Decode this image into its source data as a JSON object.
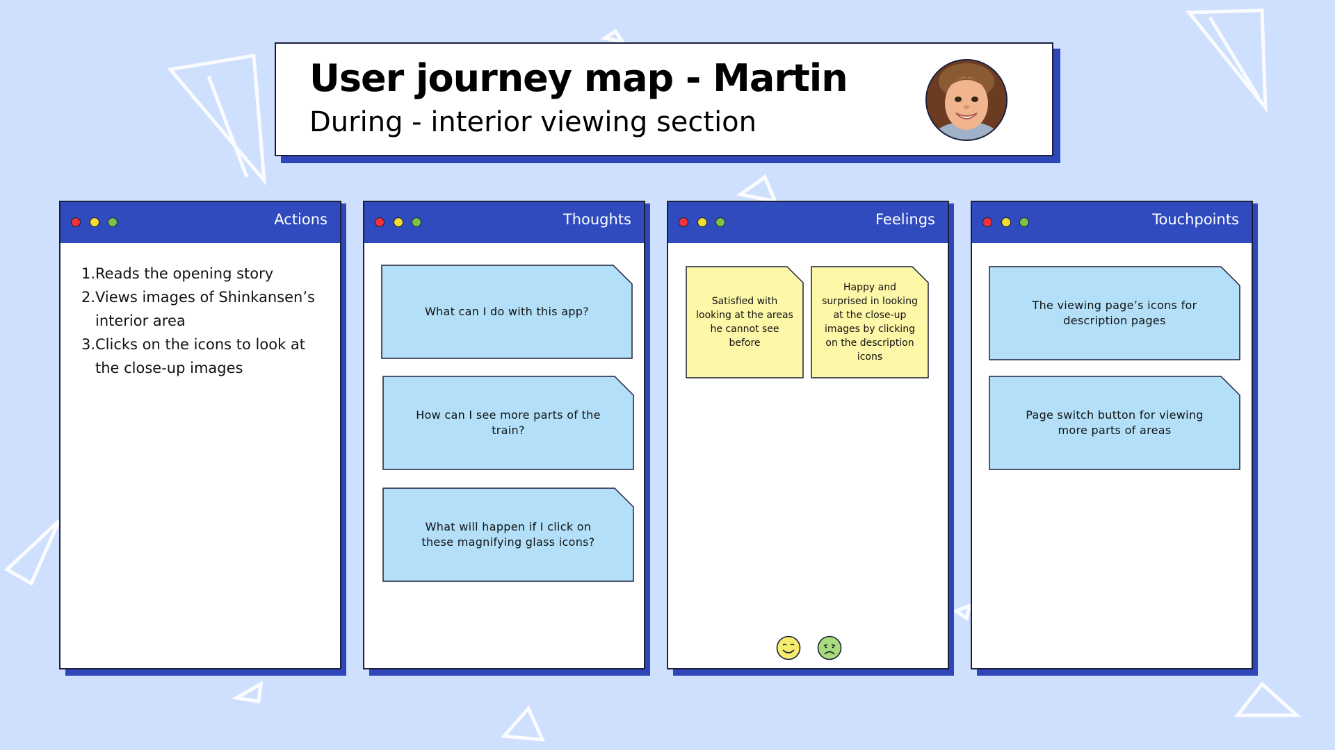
{
  "header": {
    "title": "User journey map - Martin",
    "subtitle": "During - interior viewing section",
    "avatar_icon": "child-portrait-photo"
  },
  "colors": {
    "background": "#cfe0ff",
    "panel_bar": "#2f4bbd",
    "panel_shadow": "#2f46b8",
    "blue_note": "#b3e0f8",
    "yellow_note": "#fdf7a8",
    "dot_red": "#f0323a",
    "dot_yellow": "#f4dc34",
    "dot_green": "#7cc24a"
  },
  "panels": {
    "actions": {
      "title": "Actions",
      "items": [
        {
          "num": "1.",
          "text": "Reads the opening story"
        },
        {
          "num": "2.",
          "text": "Views images of Shinkansen’s interior area"
        },
        {
          "num": "3.",
          "text": "Clicks on the icons to look at the close-up images"
        }
      ]
    },
    "thoughts": {
      "title": "Thoughts",
      "notes": [
        "What can I do with this app?",
        "How can I see more parts of the train?",
        "What will happen if I click on these magnifying glass icons?"
      ]
    },
    "feelings": {
      "title": "Feelings",
      "notes": [
        "Satisfied with looking at the areas he cannot see before",
        "Happy and surprised in looking at the close-up images by clicking on the description icons"
      ],
      "emojis": [
        "smile-emoji-icon",
        "sad-emoji-icon"
      ]
    },
    "touchpoints": {
      "title": "Touchpoints",
      "notes": [
        "The viewing page’s icons for description pages",
        "Page switch button for viewing more parts of areas"
      ]
    }
  }
}
